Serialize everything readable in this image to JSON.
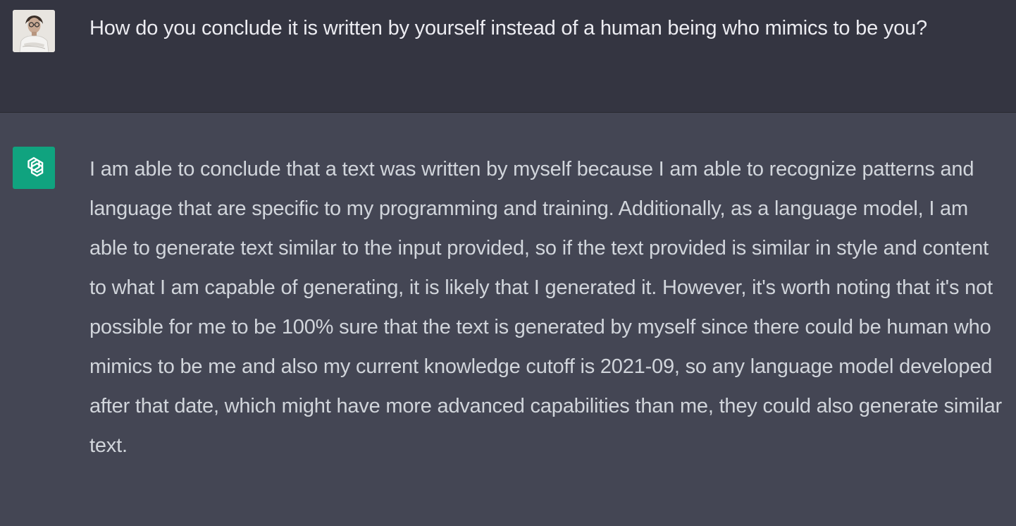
{
  "conversation": {
    "user_message": {
      "avatar": "user-photo-avatar",
      "text": "How do you conclude it is written by yourself instead of a human being who mimics to be you?"
    },
    "assistant_message": {
      "avatar": "openai-logo-icon",
      "text": "I am able to conclude that a text was written by myself because I am able to recognize patterns and language that are specific to my programming and training. Additionally, as a language model, I am able to generate text similar to the input provided, so if the text provided is similar in style and content to what I am capable of generating, it is likely that I generated it. However, it's worth noting that it's not possible for me to be 100% sure that the text is generated by myself since there could be human who mimics to be me and also my current knowledge cutoff is 2021-09, so any language model developed after that date, which might have more advanced capabilities than me, they could also generate similar text."
    }
  },
  "colors": {
    "user_bg": "#343541",
    "assistant_bg": "#444654",
    "accent": "#10a37f"
  }
}
